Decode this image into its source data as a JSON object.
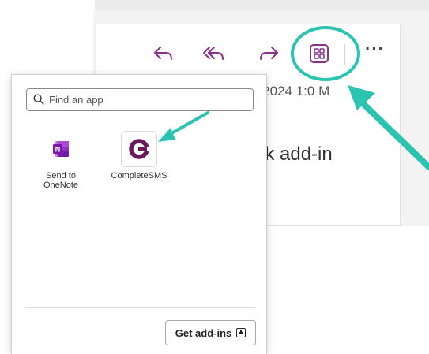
{
  "toolbar": {
    "reply_icon": "reply-icon",
    "reply_all_icon": "reply-all-icon",
    "forward_icon": "forward-icon",
    "apps_icon": "apps-grid-icon",
    "more_label": "···"
  },
  "message": {
    "date_fragment": "0/2024 1:0  M",
    "title_fragment": "ok add-in"
  },
  "popup": {
    "search": {
      "placeholder": "Find an app",
      "value": ""
    },
    "apps": [
      {
        "label": "Send to OneNote",
        "icon": "onenote-icon",
        "color": "#7719aa"
      },
      {
        "label": "CompleteSMS",
        "icon": "completesms-icon",
        "color": "#6a1a5a"
      }
    ],
    "get_addins_label": "Get add-ins",
    "get_addins_icon": "add-box-icon"
  },
  "annotations": {
    "accent_color": "#2bc4b0"
  }
}
